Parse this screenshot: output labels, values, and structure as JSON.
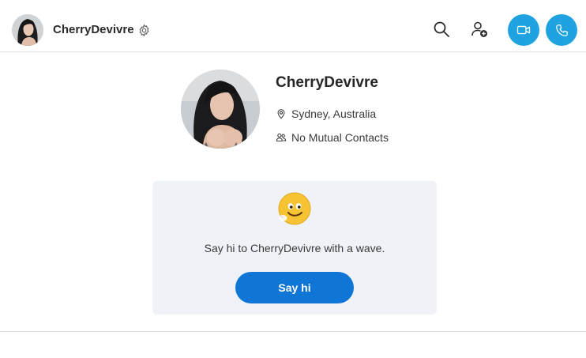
{
  "header": {
    "contact_name": "CherryDevivre",
    "icons": {
      "settings": "gear-icon",
      "search": "search-icon",
      "add_contact": "add-person-icon",
      "video_call": "video-camera-icon",
      "audio_call": "phone-icon"
    }
  },
  "profile": {
    "name": "CherryDevivre",
    "location": "Sydney, Australia",
    "mutual_contacts": "No Mutual Contacts"
  },
  "wave_card": {
    "emoji": "waving-smiley-emoji",
    "message": "Say hi to CherryDevivre with a wave.",
    "button_label": "Say hi"
  },
  "colors": {
    "call_button": "#1fa2e0",
    "primary_button": "#0f76d6",
    "card_background": "#eff2f6"
  }
}
